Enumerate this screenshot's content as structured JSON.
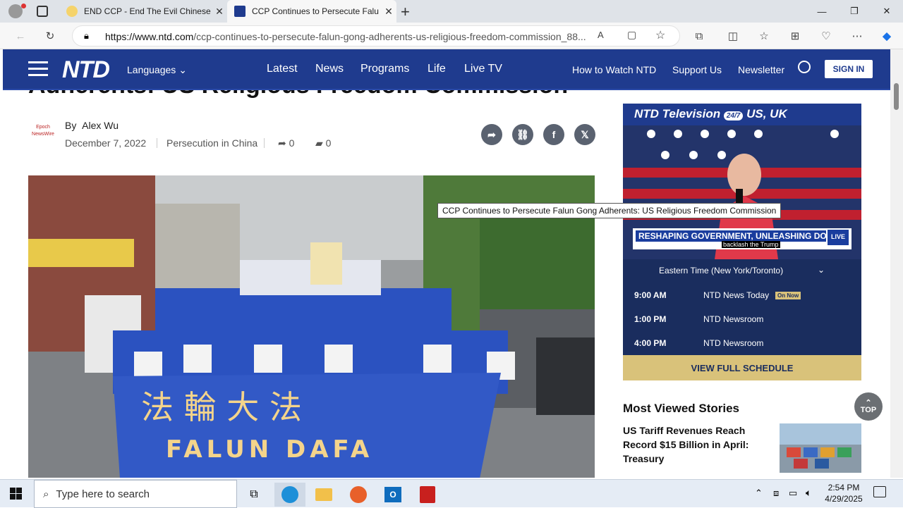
{
  "browser": {
    "tabs": [
      {
        "title": "END CCP - End The Evil Chinese",
        "active": false
      },
      {
        "title": "CCP Continues to Persecute Falu",
        "active": true
      }
    ],
    "new_tab": "+",
    "url_domain": "https://www.ntd.com",
    "url_path": "/ccp-continues-to-persecute-falun-gong-adherents-us-religious-freedom-commission_88..."
  },
  "site_nav": {
    "logo": "NTD",
    "languages": "Languages",
    "main_links": [
      "Latest",
      "News",
      "Programs",
      "Life",
      "Live TV"
    ],
    "right_links": [
      "How to Watch NTD",
      "Support Us",
      "Newsletter"
    ],
    "sign_in": "SIGN IN"
  },
  "article": {
    "headline_partial": "Adherents: US Religious Freedom Commission",
    "byline_prefix": "By",
    "author": "Alex Wu",
    "source_logo_text": "Epoch NewsWire",
    "date": "December 7, 2022",
    "category": "Persecution in China",
    "shares": "0",
    "comments": "0",
    "photo_banner_chars": "法 輪 大 法",
    "photo_banner_text": "FALUN DAFA"
  },
  "tooltip": "CCP Continues to Persecute Falun Gong Adherents: US Religious Freedom Commission",
  "live_widget": {
    "title": "NTD Television",
    "badge": "24/7",
    "region": "US, UK",
    "ticker_headline": "RESHAPING GOVERNMENT, UNLEASHING DOGE",
    "ticker_sub": "backlash the Trump",
    "live_label": "LIVE",
    "timezone": "Eastern Time (New York/Toronto)",
    "schedule": [
      {
        "time": "9:00 AM",
        "show": "NTD News Today",
        "badge": "On Now"
      },
      {
        "time": "1:00 PM",
        "show": "NTD Newsroom",
        "badge": ""
      },
      {
        "time": "4:00 PM",
        "show": "NTD Newsroom",
        "badge": ""
      }
    ],
    "view_schedule": "VIEW FULL SCHEDULE"
  },
  "most_viewed": {
    "heading": "Most Viewed Stories",
    "first_story": "US Tariff Revenues Reach Record $15 Billion in April: Treasury"
  },
  "top_button": "TOP",
  "taskbar": {
    "search_placeholder": "Type here to search",
    "time": "2:54 PM",
    "date": "4/29/2025"
  },
  "colors": {
    "nav_blue": "#1f3b8e",
    "schedule_bg": "#1a2d5e",
    "gold": "#d9c27a"
  }
}
